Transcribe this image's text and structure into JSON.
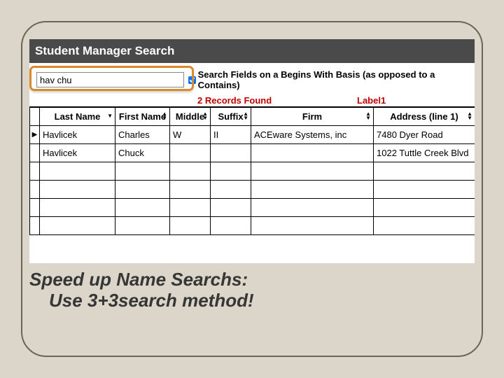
{
  "window": {
    "title": "Student Manager Search"
  },
  "search": {
    "value": "hav chu",
    "begins_with_label": "Search Fields on a Begins With Basis (as opposed to a Contains)"
  },
  "status": {
    "records_found": "2 Records Found",
    "label1": "Label1"
  },
  "columns": {
    "lastname": "Last Name",
    "firstname": "First Name",
    "middle": "Middle",
    "suffix": "Suffix",
    "firm": "Firm",
    "address1": "Address (line 1)"
  },
  "rows": [
    {
      "lastname": "Havlicek",
      "firstname": "Charles",
      "middle": "W",
      "suffix": "II",
      "firm": "ACEware Systems, inc",
      "address1": "7480 Dyer Road"
    },
    {
      "lastname": "Havlicek",
      "firstname": "Chuck",
      "middle": "",
      "suffix": "",
      "firm": "",
      "address1": "1022 Tuttle Creek Blvd"
    }
  ],
  "caption": {
    "line1": "Speed up Name Searchs:",
    "line2": "Use 3+3search method!"
  }
}
